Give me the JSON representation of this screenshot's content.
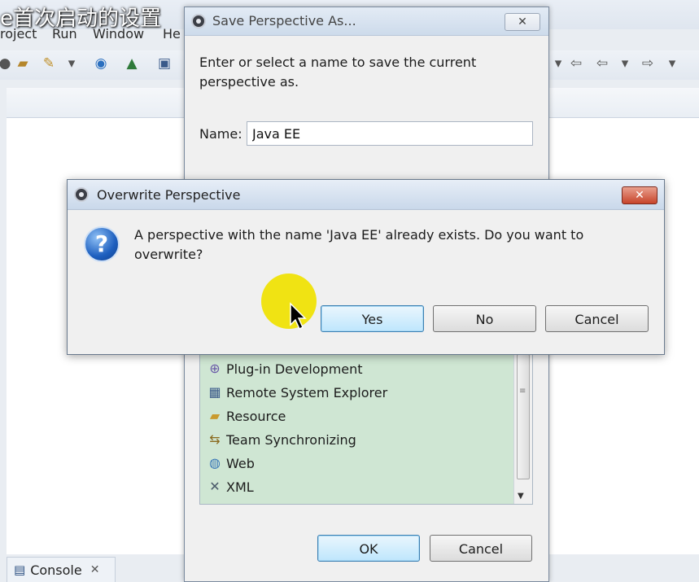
{
  "video_title": "e首次启动的设置",
  "menu": [
    "roject",
    "Run",
    "Window",
    "He"
  ],
  "console_tab": {
    "label": "Console"
  },
  "save_dialog": {
    "title": "Save Perspective As...",
    "description": "Enter or select a name to save the current perspective as.",
    "name_label": "Name:",
    "name_value": "Java EE",
    "list_items": [
      {
        "label": "Plug-in Development",
        "icon": "plugin-icon"
      },
      {
        "label": "Remote System Explorer",
        "icon": "remote-system-icon"
      },
      {
        "label": "Resource",
        "icon": "folder-icon"
      },
      {
        "label": "Team Synchronizing",
        "icon": "team-sync-icon"
      },
      {
        "label": "Web",
        "icon": "web-icon"
      },
      {
        "label": "XML",
        "icon": "xml-icon"
      }
    ],
    "ok_label": "OK",
    "cancel_label": "Cancel"
  },
  "overwrite_dialog": {
    "title": "Overwrite Perspective",
    "message": "A perspective with the name 'Java EE' already exists. Do you want to overwrite?",
    "yes_label": "Yes",
    "no_label": "No",
    "cancel_label": "Cancel",
    "close_glyph": "✕"
  },
  "colors": {
    "list_bg": "#cfe6d3",
    "close_red": "#c7442b",
    "cursor_highlight": "#f0e200"
  }
}
